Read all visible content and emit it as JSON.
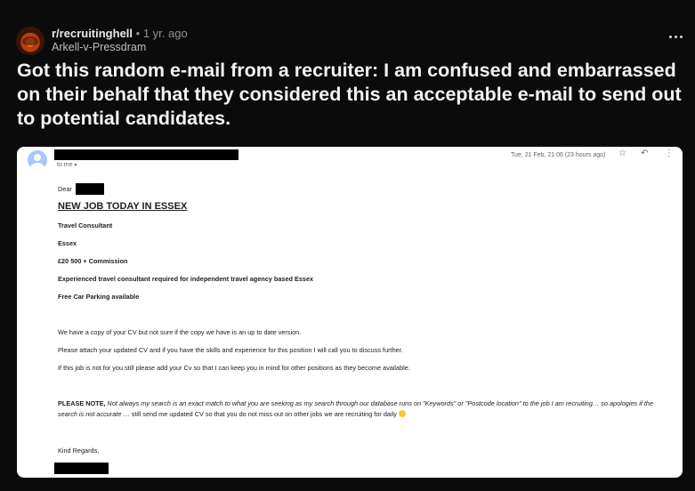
{
  "post": {
    "subreddit": "r/recruitinghell",
    "separator": "•",
    "age": "1 yr. ago",
    "username": "Arkell-v-Pressdram",
    "title": "Got this random e-mail from a recruiter: I am confused and embarrassed on their behalf that they considered this an acceptable e-mail to send out to potential candidates."
  },
  "email": {
    "to_label": "to me",
    "timestamp": "Tue, 21 Feb, 21:06 (23 hours ago)",
    "greeting": "Dear",
    "heading": "NEW JOB TODAY IN ESSEX",
    "details": [
      "Travel Consultant",
      "Essex",
      "£20 500 + Commission",
      "Experienced travel consultant required for independent travel agency based Essex",
      "Free Car Parking available"
    ],
    "paragraphs": [
      "We have a copy of your CV but not sure if the copy we have is an up to date version.",
      "Please attach your updated CV and if you have the skills and experience for this position I will call you to discuss further.",
      "If this job is not for you still please add your Cv so that I can keep you in mind for other positions as they become available."
    ],
    "note_bold": "PLEASE NOTE,",
    "note_italic_1": " Not always my search is an exact match to what you are seeking as my search through our database runs on \"Keywords\" or \"Postcode location\" to the job I am recruiting… so apologies if the search is not accurate",
    "note_normal": " … still send me updated CV so that you do not miss out on other jobs we are recruiting for daily ",
    "sign_off": "Kind Regards,"
  },
  "icons": {
    "star": "☆",
    "reply": "↶",
    "more": "⋮",
    "caret": "▾"
  }
}
